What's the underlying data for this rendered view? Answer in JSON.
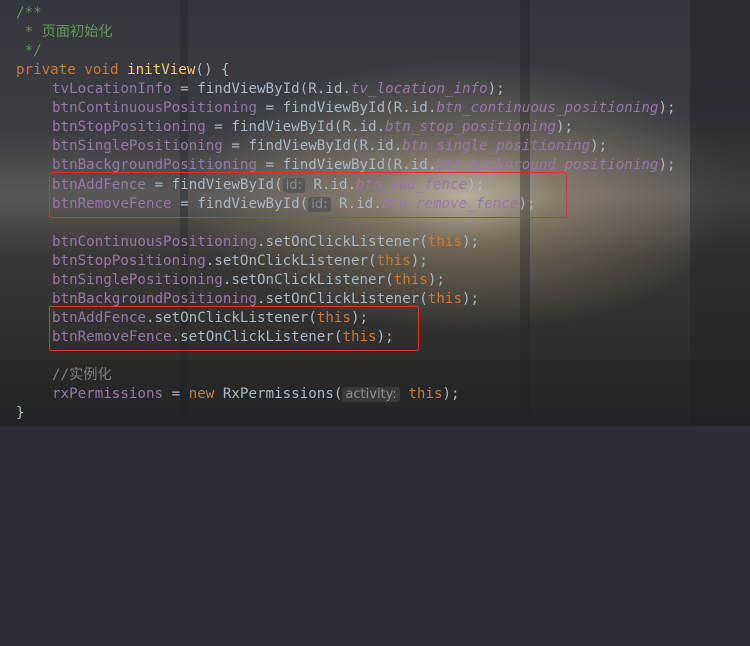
{
  "code": {
    "doc_open": "/**",
    "doc_text": " * 页面初始化",
    "doc_close": " */",
    "sig_private": "private",
    "sig_void": "void",
    "sig_name": "initView",
    "sig_rest": "() {",
    "find_lines": [
      {
        "field": "tvLocationInfo",
        "mid": " = findViewById(R.id.",
        "id": "tv_location_info",
        "end": ");"
      },
      {
        "field": "btnContinuousPositioning",
        "mid": " = findViewById(R.id.",
        "id": "btn_continuous_positioning",
        "end": ");"
      },
      {
        "field": "btnStopPositioning",
        "mid": " = findViewById(R.id.",
        "id": "btn_stop_positioning",
        "end": ");"
      },
      {
        "field": "btnSinglePositioning",
        "mid": " = findViewById(R.id.",
        "id": "btn_single_positioning",
        "end": ");"
      },
      {
        "field": "btnBackgroundPositioning",
        "mid": " = findViewById(R.id.",
        "id": "btn_background_positioning",
        "end": ");"
      }
    ],
    "fence_find_lines": [
      {
        "field": "btnAddFence",
        "mid": " = findViewById(",
        "hint": "id:",
        "mid2": " R.id.",
        "id": "btn_add_fence",
        "end": ");"
      },
      {
        "field": "btnRemoveFence",
        "mid": " = findViewById(",
        "hint": "id:",
        "mid2": " R.id.",
        "id": "btn_remove_fence",
        "end": ");"
      }
    ],
    "listener_lines": [
      {
        "field": "btnContinuousPositioning",
        "call": ".setOnClickListener(",
        "arg": "this",
        "end": ");"
      },
      {
        "field": "btnStopPositioning",
        "call": ".setOnClickListener(",
        "arg": "this",
        "end": ");"
      },
      {
        "field": "btnSinglePositioning",
        "call": ".setOnClickListener(",
        "arg": "this",
        "end": ");"
      },
      {
        "field": "btnBackgroundPositioning",
        "call": ".setOnClickListener(",
        "arg": "this",
        "end": ");"
      }
    ],
    "fence_listener_lines": [
      {
        "field": "btnAddFence",
        "call": ".setOnClickListener(",
        "arg": "this",
        "end": ");"
      },
      {
        "field": "btnRemoveFence",
        "call": ".setOnClickListener(",
        "arg": "this",
        "end": ");"
      }
    ],
    "comment_line": "//实例化",
    "perm_field": "rxPermissions",
    "perm_eq": " = ",
    "perm_new": "new",
    "perm_class": " RxPermissions(",
    "perm_hint": "activity:",
    "perm_arg": "this",
    "perm_end": ");",
    "close_brace": "}"
  },
  "colors": {
    "keyword": "#cc7832",
    "method": "#ffc66d",
    "field": "#9876aa",
    "comment": "#629755",
    "text": "#a9b7c6",
    "highlight_box": "#e0302c"
  }
}
